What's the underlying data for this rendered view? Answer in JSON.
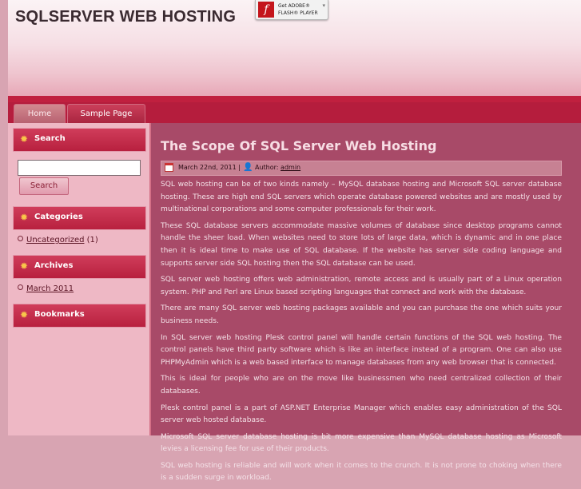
{
  "site": {
    "title": "SQLSERVER WEB HOSTING"
  },
  "flash_badge": {
    "line1": "Get ADOBE®",
    "line2": "FLASH® PLAYER",
    "logo": "f"
  },
  "nav": {
    "tabs": [
      {
        "label": "Home"
      },
      {
        "label": "Sample Page"
      }
    ]
  },
  "sidebar": {
    "search": {
      "title": "Search",
      "input_value": "",
      "button_label": "Search"
    },
    "categories": {
      "title": "Categories",
      "items": [
        {
          "label": "Uncategorized",
          "count": "(1)"
        }
      ]
    },
    "archives": {
      "title": "Archives",
      "items": [
        {
          "label": "March 2011"
        }
      ]
    },
    "bookmarks": {
      "title": "Bookmarks"
    }
  },
  "post": {
    "title": "The Scope Of SQL Server Web Hosting",
    "date": "March 22nd, 2011 |",
    "author_prefix": "Author:",
    "author": "admin",
    "paragraphs": [
      "SQL web hosting can be of two kinds namely – MySQL database hosting and Microsoft SQL server database hosting. These are high end SQL servers which operate database powered websites and are mostly used by multinational corporations and some computer professionals for their work.",
      "These SQL database servers accommodate massive volumes of database since desktop programs cannot handle the sheer load. When websites need to store lots of large data, which is dynamic and in one place then it is ideal time to make use of SQL database. If the website has server side coding language and supports server side SQL hosting then the SQL database can be used.",
      "SQL server web hosting offers web administration, remote access and is usually part of a Linux operation system. PHP and Perl are Linux based scripting languages that connect and work with the database.",
      "There are many SQL server web hosting packages available and you can purchase the one which suits your business needs.",
      "In SQL server web hosting Plesk control panel will handle certain functions of the SQL web hosting. The control panels have third party software which is like an interface instead of a program. One can also use PHPMyAdmin which is a web based interface to manage databases from any web browser that is connected.",
      "This is ideal for people who are on the move like businessmen who need centralized collection of their databases.",
      "Plesk control panel is a part of ASP.NET Enterprise Manager which enables easy administration of the SQL server web hosted database.",
      "Microsoft SQL server database hosting is bit more expensive than MySQL database hosting as Microsoft levies a licensing fee for use of their products.",
      "SQL web hosting is reliable and will work when it comes to the crunch. It is not prone to choking when there is a sudden surge in workload."
    ]
  }
}
